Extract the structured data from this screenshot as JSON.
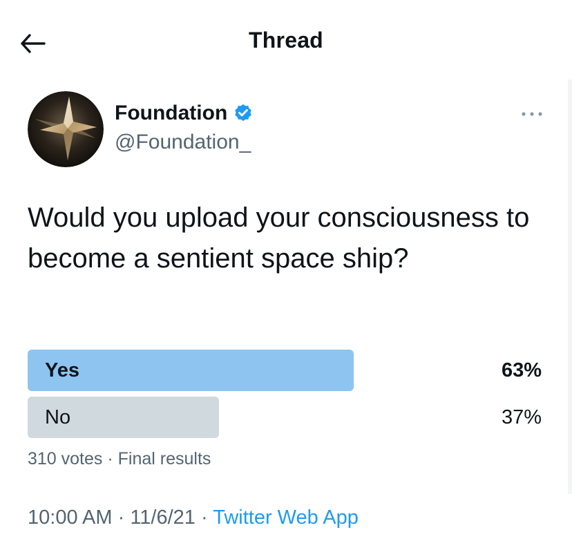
{
  "header": {
    "title": "Thread"
  },
  "author": {
    "display_name": "Foundation",
    "handle": "@Foundation_",
    "verified": true
  },
  "tweet": {
    "text": "Would you upload your consciousness to become a sentient space ship?"
  },
  "poll": {
    "options": [
      {
        "label": "Yes",
        "percent_text": "63%",
        "percent": 63,
        "winner": true
      },
      {
        "label": "No",
        "percent_text": "37%",
        "percent": 37,
        "winner": false
      }
    ],
    "votes_text": "310 votes",
    "separator": "·",
    "status_text": "Final results"
  },
  "meta": {
    "time": "10:00 AM",
    "date": "11/6/21",
    "separator": "·",
    "source": "Twitter Web App"
  },
  "colors": {
    "winner_bar": "#8ec4f0",
    "other_bar": "#cfd9de",
    "verified": "#1d9bf0",
    "secondary_text": "#536471",
    "link": "#1d9bf0"
  },
  "icons": {
    "back": "arrow-left-icon",
    "verified": "verified-badge-icon",
    "more": "more-horizontal-icon"
  }
}
